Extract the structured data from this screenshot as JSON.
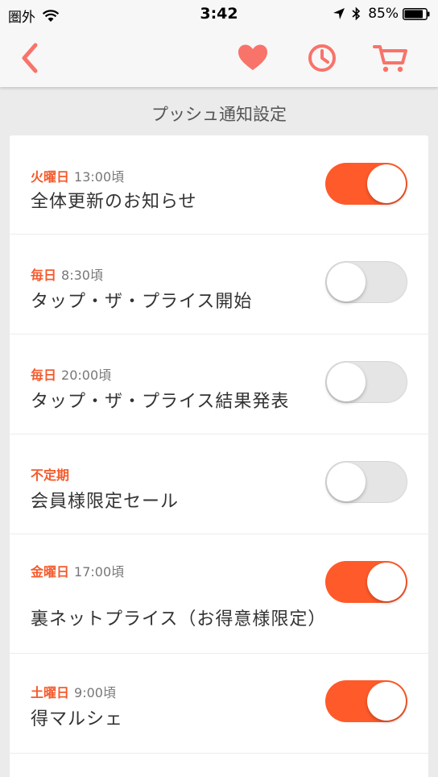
{
  "status_bar": {
    "carrier": "圏外",
    "time": "3:42",
    "battery": "85%"
  },
  "nav": {
    "icons": [
      "back-chevron-icon",
      "heart-icon",
      "clock-icon",
      "cart-icon"
    ],
    "accent": "#f8736a"
  },
  "section_title": "プッシュ通知設定",
  "colors": {
    "toggle_on": "#ff5a2a",
    "day_label": "#f55a2c"
  },
  "notifications": [
    {
      "day": "火曜日",
      "time": "13:00頃",
      "label": "全体更新のお知らせ",
      "enabled": true
    },
    {
      "day": "毎日",
      "time": "8:30頃",
      "label": "タップ・ザ・プライス開始",
      "enabled": false
    },
    {
      "day": "毎日",
      "time": "20:00頃",
      "label": "タップ・ザ・プライス結果発表",
      "enabled": false
    },
    {
      "day": "不定期",
      "time": "",
      "label": "会員様限定セール",
      "enabled": false
    },
    {
      "day": "金曜日",
      "time": "17:00頃",
      "label": "裏ネットプライス（お得意様限定）",
      "enabled": true
    },
    {
      "day": "土曜日",
      "time": "9:00頃",
      "label": "得マルシェ",
      "enabled": true
    }
  ]
}
